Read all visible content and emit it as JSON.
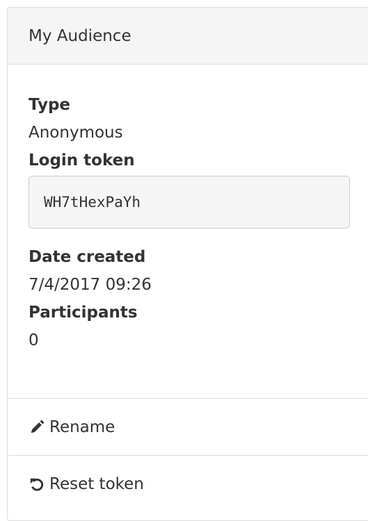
{
  "panel": {
    "title": "My Audience"
  },
  "details": {
    "type_label": "Type",
    "type_value": "Anonymous",
    "token_label": "Login token",
    "token_value": "WH7tHexPaYh",
    "date_label": "Date created",
    "date_value": "7/4/2017 09:26",
    "participants_label": "Participants",
    "participants_value": "0"
  },
  "actions": {
    "rename_label": "Rename",
    "rename_icon": "pencil-icon",
    "reset_label": "Reset token",
    "reset_icon": "undo-icon"
  }
}
